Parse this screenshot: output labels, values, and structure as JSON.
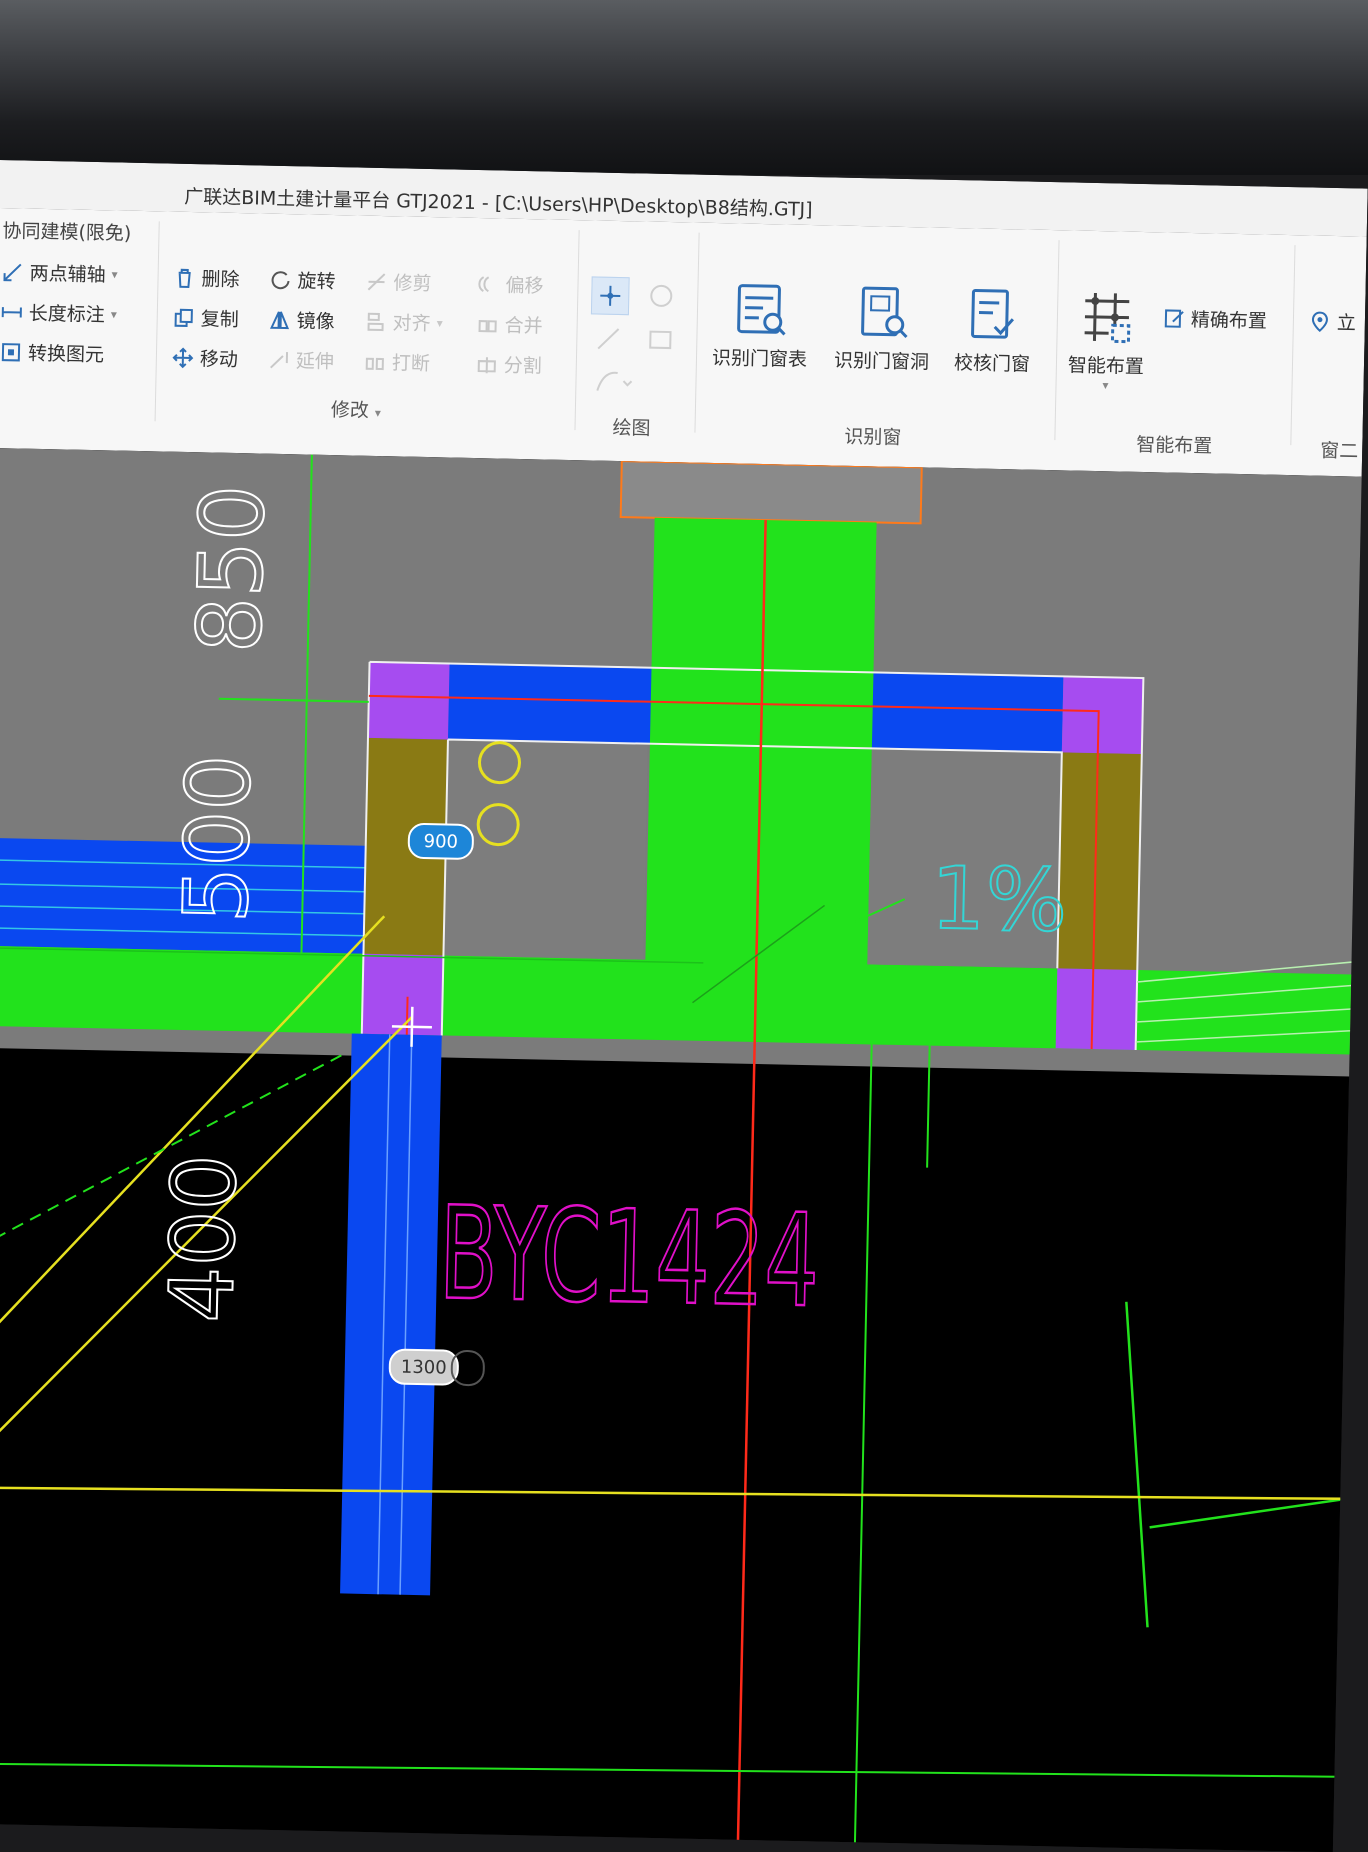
{
  "window": {
    "title": "广联达BIM土建计量平台 GTJ2021 - [C:\\Users\\HP\\Desktop\\B8结构.GTJ]",
    "tab_label": "协同建模(限免)"
  },
  "ribbon": {
    "aux_group": {
      "items": [
        "两点辅轴",
        "长度标注",
        "转换图元"
      ]
    },
    "modify_group": {
      "label": "修改",
      "items": [
        {
          "label": "删除",
          "icon": "delete-icon",
          "enabled": true
        },
        {
          "label": "旋转",
          "icon": "rotate-icon",
          "enabled": true
        },
        {
          "label": "修剪",
          "icon": "trim-icon",
          "enabled": false
        },
        {
          "label": "偏移",
          "icon": "offset-icon",
          "enabled": false
        },
        {
          "label": "复制",
          "icon": "copy-icon",
          "enabled": true
        },
        {
          "label": "镜像",
          "icon": "mirror-icon",
          "enabled": true
        },
        {
          "label": "对齐",
          "icon": "align-icon",
          "enabled": false
        },
        {
          "label": "合并",
          "icon": "merge-icon",
          "enabled": false
        },
        {
          "label": "移动",
          "icon": "move-icon",
          "enabled": true
        },
        {
          "label": "延伸",
          "icon": "extend-icon",
          "enabled": false
        },
        {
          "label": "打断",
          "icon": "break-icon",
          "enabled": false
        },
        {
          "label": "分割",
          "icon": "split-icon",
          "enabled": false
        }
      ]
    },
    "draw_group": {
      "label": "绘图"
    },
    "identify_group": {
      "label": "识别窗",
      "items": [
        "识别门窗表",
        "识别门窗洞",
        "校核门窗"
      ]
    },
    "smart_group": {
      "label": "智能布置",
      "items": [
        "智能布置",
        "精确布置"
      ]
    },
    "partial_right": {
      "label": "立",
      "group": "窗二"
    }
  },
  "canvas": {
    "dimensions": [
      "850",
      "500",
      "400"
    ],
    "slope_label": "1%",
    "window_code": "BYC1424",
    "input_badges": [
      "900",
      "1300"
    ],
    "colors": {
      "background": "#000000",
      "wall_green": "#22e21c",
      "beam_blue": "#0a48f0",
      "column_purple": "#a64cf0",
      "wall_olive": "#8a7a14",
      "gray_area": "#7b7b7b",
      "text_magenta": "#e010c8",
      "text_cyan": "#33d6d6",
      "line_yellow": "#e6e020",
      "line_red": "#ff2a1a",
      "line_orange": "#ff7a1a"
    }
  }
}
